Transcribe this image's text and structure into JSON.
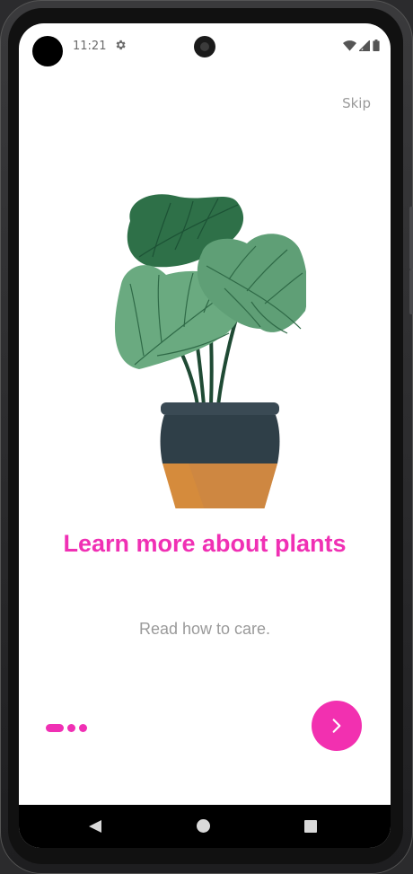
{
  "status_bar": {
    "time": "11:21"
  },
  "onboarding": {
    "skip_label": "Skip",
    "title": "Learn more about plants",
    "subtitle": "Read how to care.",
    "page_count": 3,
    "current_page": 1
  },
  "icons": {
    "settings": "gear-icon",
    "wifi": "wifi-icon",
    "signal": "cell-signal-icon",
    "battery": "battery-icon",
    "next": "chevron-right-icon",
    "back": "nav-back-icon",
    "home": "nav-home-icon",
    "recents": "nav-recents-icon"
  },
  "colors": {
    "accent": "#f030b4",
    "secondary_text": "#9a9a9a",
    "pot_top": "#2f3f48",
    "pot_bottom": "#d58b3c",
    "leaf_dark": "#2e7048",
    "leaf_light": "#6aaa80"
  }
}
